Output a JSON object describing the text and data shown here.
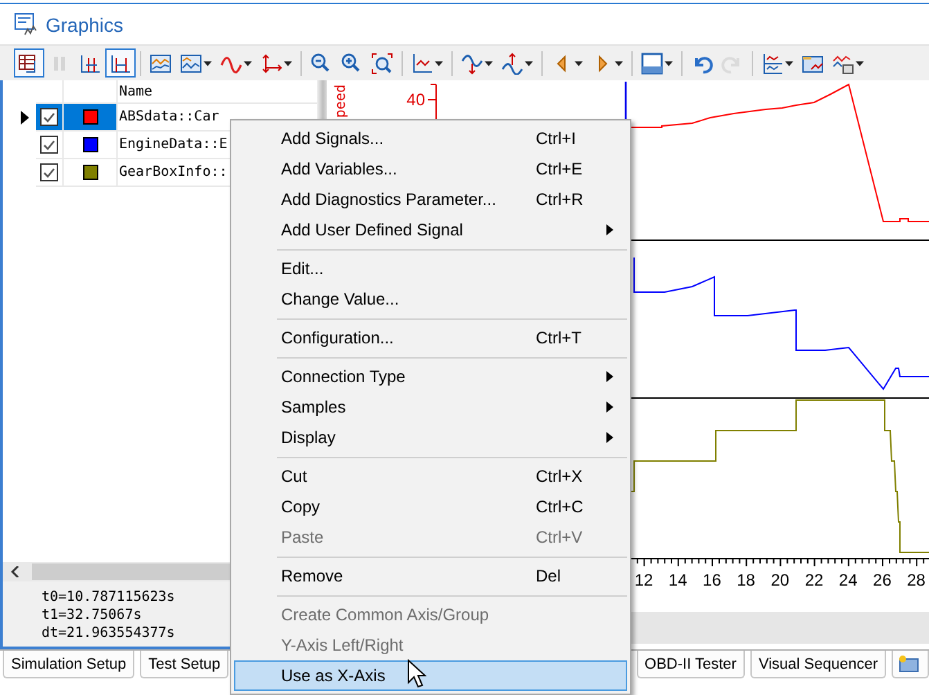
{
  "window": {
    "title": "Graphics"
  },
  "toolbar": [
    {
      "kind": "button",
      "on": true,
      "disabled": false,
      "dropdown": false
    },
    {
      "kind": "button",
      "on": false,
      "disabled": true,
      "dropdown": false
    },
    {
      "kind": "button",
      "on": false,
      "disabled": false,
      "dropdown": false
    },
    {
      "kind": "button",
      "on": true,
      "disabled": false,
      "dropdown": false
    },
    {
      "kind": "separator"
    },
    {
      "kind": "button",
      "on": false,
      "disabled": false,
      "dropdown": false
    },
    {
      "kind": "button",
      "on": false,
      "disabled": false,
      "dropdown": true
    },
    {
      "kind": "button",
      "on": false,
      "disabled": false,
      "dropdown": true
    },
    {
      "kind": "button",
      "on": false,
      "disabled": false,
      "dropdown": true
    },
    {
      "kind": "separator"
    },
    {
      "kind": "button",
      "on": false,
      "disabled": false,
      "dropdown": false
    },
    {
      "kind": "button",
      "on": false,
      "disabled": false,
      "dropdown": false
    },
    {
      "kind": "button",
      "on": false,
      "disabled": false,
      "dropdown": false
    },
    {
      "kind": "separator"
    },
    {
      "kind": "button",
      "on": false,
      "disabled": false,
      "dropdown": true
    },
    {
      "kind": "separator"
    },
    {
      "kind": "button",
      "on": false,
      "disabled": false,
      "dropdown": true
    },
    {
      "kind": "button",
      "on": false,
      "disabled": false,
      "dropdown": true
    },
    {
      "kind": "separator"
    },
    {
      "kind": "button",
      "on": false,
      "disabled": false,
      "dropdown": true
    },
    {
      "kind": "button",
      "on": false,
      "disabled": false,
      "dropdown": true
    },
    {
      "kind": "separator"
    },
    {
      "kind": "button",
      "on": false,
      "disabled": false,
      "dropdown": true
    },
    {
      "kind": "separator"
    },
    {
      "kind": "button",
      "on": false,
      "disabled": false,
      "dropdown": false
    },
    {
      "kind": "button",
      "on": false,
      "disabled": true,
      "dropdown": false
    },
    {
      "kind": "separator"
    },
    {
      "kind": "button",
      "on": false,
      "disabled": false,
      "dropdown": true
    },
    {
      "kind": "button",
      "on": false,
      "disabled": false,
      "dropdown": false
    },
    {
      "kind": "button",
      "on": false,
      "disabled": false,
      "dropdown": true
    }
  ],
  "signal_list": {
    "column_name": "Name",
    "signals": [
      {
        "name": "ABSdata::Car",
        "checked": true,
        "color": "#ff0000",
        "selected": true
      },
      {
        "name": "EngineData::E",
        "checked": true,
        "color": "#0000ff",
        "selected": false
      },
      {
        "name": "GearBoxInfo::",
        "checked": true,
        "color": "#808000",
        "selected": false
      }
    ]
  },
  "cursor_info": [
    "t0=10.787115623s",
    "t1=32.75067s",
    "dt=21.963554377s"
  ],
  "chart": {
    "y_axis_label": "peed",
    "y_tick": "40",
    "x_tick_labels": [
      "12",
      "14",
      "16",
      "18",
      "20",
      "22",
      "24",
      "26",
      "28"
    ]
  },
  "context_menu": [
    {
      "kind": "item",
      "label": "Add Signals...",
      "shortcut": "Ctrl+I",
      "submenu": false,
      "disabled": false,
      "selected": false
    },
    {
      "kind": "item",
      "label": "Add Variables...",
      "shortcut": "Ctrl+E",
      "submenu": false,
      "disabled": false,
      "selected": false
    },
    {
      "kind": "item",
      "label": "Add Diagnostics Parameter...",
      "shortcut": "Ctrl+R",
      "submenu": false,
      "disabled": false,
      "selected": false
    },
    {
      "kind": "item",
      "label": "Add User Defined Signal",
      "submenu": true,
      "disabled": false,
      "selected": false
    },
    {
      "kind": "separator"
    },
    {
      "kind": "item",
      "label": "Edit...",
      "submenu": false,
      "disabled": false,
      "selected": false
    },
    {
      "kind": "item",
      "label": "Change Value...",
      "submenu": false,
      "disabled": false,
      "selected": false
    },
    {
      "kind": "separator"
    },
    {
      "kind": "item",
      "label": "Configuration...",
      "shortcut": "Ctrl+T",
      "submenu": false,
      "disabled": false,
      "selected": false
    },
    {
      "kind": "separator"
    },
    {
      "kind": "item",
      "label": "Connection Type",
      "submenu": true,
      "disabled": false,
      "selected": false
    },
    {
      "kind": "item",
      "label": "Samples",
      "submenu": true,
      "disabled": false,
      "selected": false
    },
    {
      "kind": "item",
      "label": "Display",
      "submenu": true,
      "disabled": false,
      "selected": false
    },
    {
      "kind": "separator"
    },
    {
      "kind": "item",
      "label": "Cut",
      "shortcut": "Ctrl+X",
      "submenu": false,
      "disabled": false,
      "selected": false
    },
    {
      "kind": "item",
      "label": "Copy",
      "shortcut": "Ctrl+C",
      "submenu": false,
      "disabled": false,
      "selected": false
    },
    {
      "kind": "item",
      "label": "Paste",
      "shortcut": "Ctrl+V",
      "submenu": false,
      "disabled": true,
      "selected": false
    },
    {
      "kind": "separator"
    },
    {
      "kind": "item",
      "label": "Remove",
      "shortcut": "Del",
      "submenu": false,
      "disabled": false,
      "selected": false
    },
    {
      "kind": "separator"
    },
    {
      "kind": "item",
      "label": "Create Common Axis/Group",
      "submenu": false,
      "disabled": true,
      "selected": false
    },
    {
      "kind": "item",
      "label": "Y-Axis Left/Right",
      "submenu": false,
      "disabled": true,
      "selected": false
    },
    {
      "kind": "item",
      "label": "Use as X-Axis",
      "submenu": false,
      "disabled": false,
      "selected": true
    }
  ],
  "bottom_tabs": [
    {
      "label": "Simulation Setup"
    },
    {
      "label": "Test Setup"
    },
    {
      "label": "OBD-II Tester"
    },
    {
      "label": "Visual Sequencer"
    }
  ]
}
